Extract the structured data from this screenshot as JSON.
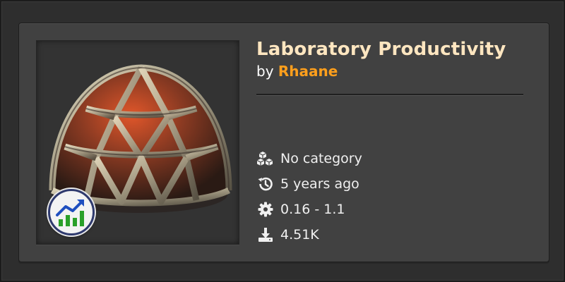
{
  "mod": {
    "title": "Laboratory Productivity",
    "by_label": "by",
    "author": "Rhaane"
  },
  "meta": {
    "category": "No category",
    "updated": "5 years ago",
    "version_range": "0.16 - 1.1",
    "downloads": "4.51K"
  },
  "icons": {
    "thumbnail": "laboratory-dome-icon",
    "badge": "productivity-chart-icon",
    "category": "cubes-icon",
    "updated": "history-icon",
    "version": "gear-icon",
    "downloads": "download-icon"
  },
  "colors": {
    "title": "#ffe6c0",
    "author": "#ff9f1c",
    "card": "#414141"
  }
}
